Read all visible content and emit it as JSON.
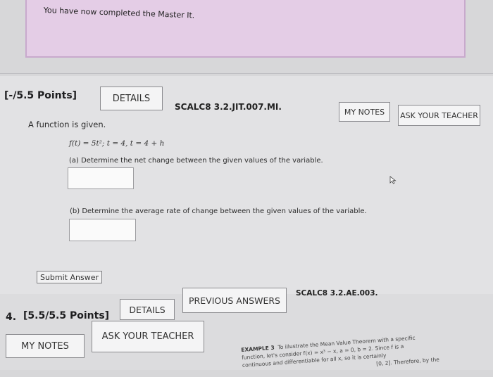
{
  "banner": {
    "text": "You have now completed the Master It."
  },
  "question3": {
    "points_label": "[-/5.5 Points]",
    "details_label": "DETAILS",
    "course_code": "SCALC8 3.2.JIT.007.MI.",
    "my_notes_label": "MY NOTES",
    "ask_teacher_label": "ASK YOUR TEACHER",
    "prompt": "A function is given.",
    "function_text": "f(t) = 5t²;    t = 4, t = 4 + h",
    "part_a": "(a) Determine the net change between the given values of the variable.",
    "part_b": "(b) Determine the average rate of change between the given values of the variable.",
    "part_a_value": "",
    "part_b_value": "",
    "submit_label": "Submit Answer"
  },
  "question4": {
    "number": "4.",
    "points_label": "[5.5/5.5 Points]",
    "details_label": "DETAILS",
    "previous_answers_label": "PREVIOUS ANSWERS",
    "course_code": "SCALC8 3.2.AE.003.",
    "my_notes_label": "MY NOTES",
    "ask_teacher_label": "ASK YOUR TEACHER",
    "example_heading": "EXAMPLE 3",
    "example_line1": "To illustrate the Mean Value Theorem with a specific",
    "example_line2": "function, let's consider f(x) = x³ − x,  a = 0,  b = 2.  Since f is a",
    "example_line3": "continuous and differentiable for all x, so it is certainly",
    "example_line4": "[0, 2]. Therefore, by the"
  },
  "icons": {
    "cursor": "mouse-pointer-icon"
  }
}
